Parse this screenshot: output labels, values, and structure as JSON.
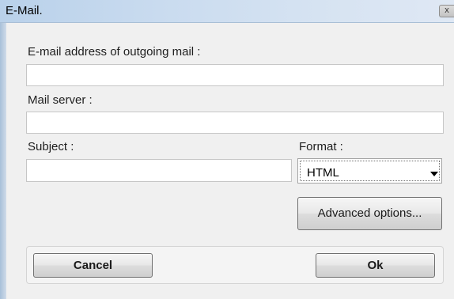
{
  "window": {
    "title": "E-Mail.",
    "close_glyph": "x"
  },
  "form": {
    "email_label": "E-mail address of outgoing mail :",
    "email_value": "",
    "server_label": "Mail server :",
    "server_value": "",
    "subject_label": "Subject :",
    "subject_value": "",
    "format_label": "Format :",
    "format_value": "HTML"
  },
  "buttons": {
    "advanced_label": "Advanced options...",
    "cancel_label": "Cancel",
    "ok_label": "Ok"
  },
  "icons": {
    "close": "close-icon",
    "dropdown": "chevron-down-icon"
  }
}
